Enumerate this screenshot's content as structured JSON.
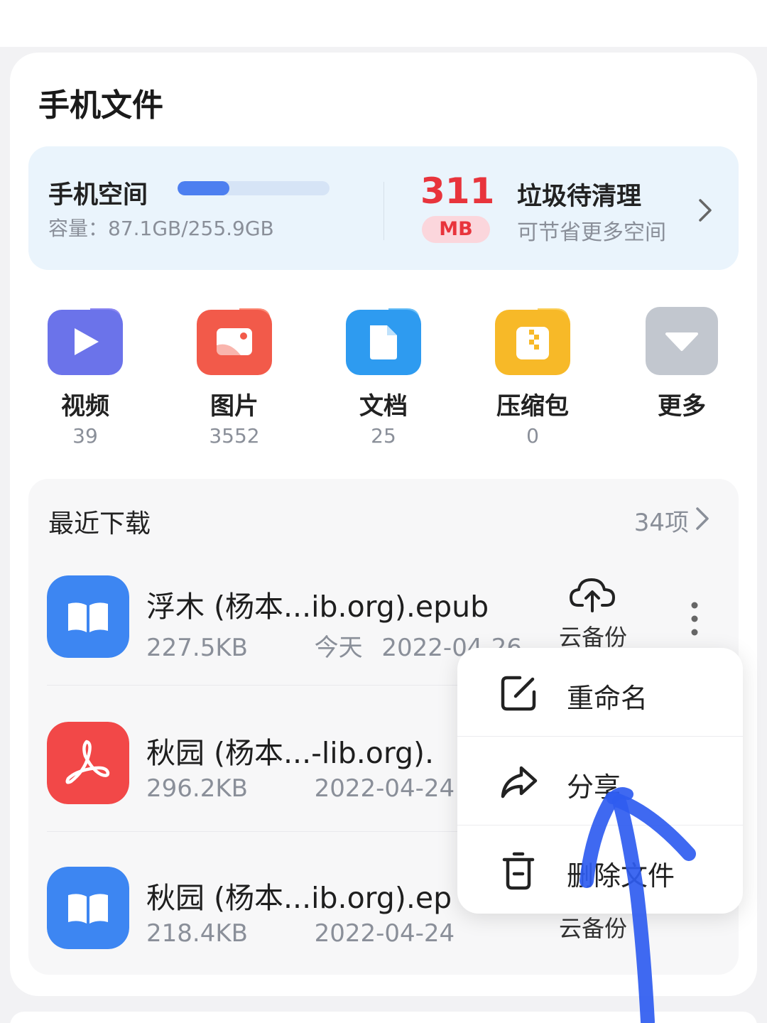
{
  "page_title": "手机文件",
  "storage": {
    "title": "手机空间",
    "capacity_text": "容量：87.1GB/255.9GB",
    "used_fraction": 0.34,
    "trash_size": "311",
    "trash_unit": "MB",
    "trash_title": "垃圾待清理",
    "trash_subtitle": "可节省更多空间"
  },
  "categories": [
    {
      "label": "视频",
      "count": "39",
      "icon": "video-icon",
      "color": "#6b73ea"
    },
    {
      "label": "图片",
      "count": "3552",
      "icon": "image-icon",
      "color": "#f25a4a"
    },
    {
      "label": "文档",
      "count": "25",
      "icon": "document-icon",
      "color": "#2e9bf0"
    },
    {
      "label": "压缩包",
      "count": "0",
      "icon": "archive-icon",
      "color": "#f7b928"
    },
    {
      "label": "更多",
      "count": "",
      "icon": "more-dropdown-icon",
      "color": "#c2c7cf"
    }
  ],
  "recent": {
    "title": "最近下载",
    "count_label": "34项",
    "files": [
      {
        "name": "浮木 (杨本...ib.org).epub",
        "size": "227.5KB",
        "date": "今天 2022-04-26",
        "action": "云备份",
        "type": "epub"
      },
      {
        "name": "秋园 (杨本...-lib.org).",
        "size": "296.2KB",
        "date": "2022-04-24",
        "action": "",
        "type": "pdf"
      },
      {
        "name": "秋园 (杨本...ib.org).ep",
        "size": "218.4KB",
        "date": "2022-04-24",
        "action": "云备份",
        "type": "epub"
      }
    ]
  },
  "menu": {
    "items": [
      {
        "label": "重命名",
        "icon": "rename-icon"
      },
      {
        "label": "分享",
        "icon": "share-icon"
      },
      {
        "label": "删除文件",
        "icon": "trash-icon"
      }
    ]
  },
  "colors": {
    "accent_blue": "#4d7ff0",
    "trash_red": "#e8343c",
    "annotation_blue": "#2f5cf0"
  }
}
